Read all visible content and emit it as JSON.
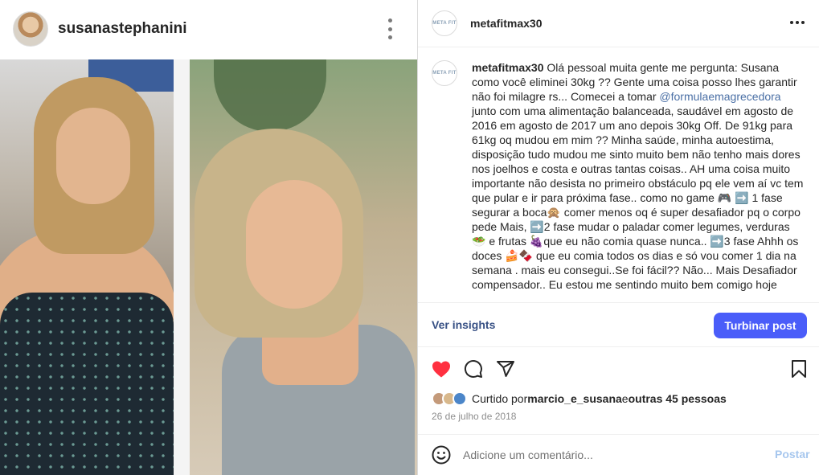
{
  "left": {
    "username": "susanastephanini"
  },
  "post": {
    "username": "metafitmax30",
    "avatar_text": "META FIT",
    "caption": {
      "user": "metafitmax30",
      "text_before_mention": "Olá pessoal muita gente me pergunta: Susana como você eliminei 30kg ?? Gente uma coisa posso lhes garantir não foi milagre rs... Comecei a tomar ",
      "mention": "@formulaemagrecedora",
      "text_after_mention": " junto com uma alimentação balanceada, saudável em agosto de 2016 em agosto de 2017 um ano depois 30kg Off. De 91kg para 61kg oq mudou em mim ?? Minha saúde, minha autoestima, disposição tudo mudou me sinto muito bem não tenho mais dores nos joelhos e costa e outras tantas coisas.. AH uma coisa muito importante não desista no primeiro obstáculo pq ele vem aí vc tem que pular e ir para próxima fase.. como no game 🎮 ➡️ 1 fase segurar a boca🙊 comer menos oq é super desafiador pq o corpo pede Mais, ➡️2 fase mudar o paladar comer legumes, verduras 🥗 e frutas 🍇que eu não comia quase nunca.. ➡️3 fase Ahhh os doces 🍰🍫 que eu comia todos os dias e só vou comer 1 dia na semana . mais eu consegui..Se foi fácil?? Não... Mais Desafiador compensador.. Eu estou me sentindo muito bem comigo hoje"
    },
    "insights_label": "Ver insights",
    "boost_label": "Turbinar post",
    "likes": {
      "prefix": "Curtido por ",
      "user": "marcio_e_susana",
      "middle": " e ",
      "others": "outras 45 pessoas"
    },
    "date": "26 de julho de 2018",
    "comment_placeholder": "Adicione um comentário...",
    "post_label": "Postar"
  },
  "icons": {
    "like": "heart-filled-icon",
    "comment": "comment-icon",
    "share": "paper-plane-icon",
    "save": "bookmark-icon",
    "more": "more-horizontal-icon",
    "kebab": "more-vertical-icon",
    "emoji": "emoji-icon"
  },
  "colors": {
    "like_red": "#ff3040",
    "boost_blue": "#4a5df9",
    "link": "#385185"
  }
}
